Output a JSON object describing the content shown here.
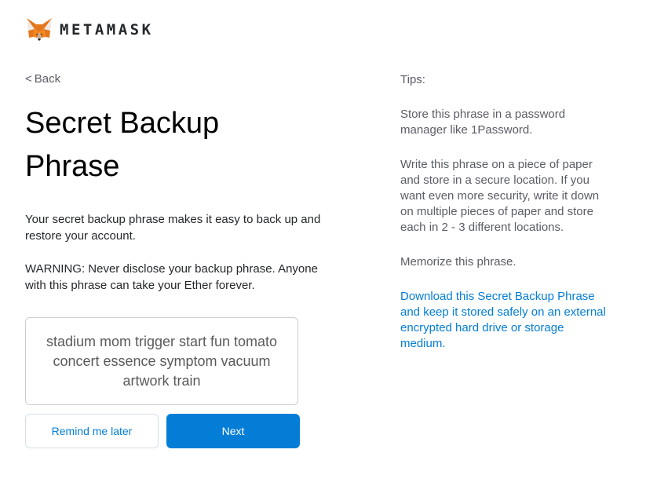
{
  "header": {
    "brand": "METAMASK",
    "logo_icon": "metamask-fox-icon"
  },
  "nav": {
    "back_chevron": "<",
    "back_label": "Back"
  },
  "main": {
    "title": "Secret Backup Phrase",
    "description": "Your secret backup phrase makes it easy to back up and restore your account.",
    "warning": "WARNING: Never disclose your backup phrase. Anyone with this phrase can take your Ether forever.",
    "seed_phrase": "stadium mom trigger start fun tomato concert essence symptom vacuum artwork train"
  },
  "buttons": {
    "remind_label": "Remind me later",
    "next_label": "Next"
  },
  "tips": {
    "heading": "Tips:",
    "items": [
      "Store this phrase in a password manager like 1Password.",
      "Write this phrase on a piece of paper and store in a secure location. If you want even more security, write it down on multiple pieces of paper and store each in 2 - 3 different locations.",
      "Memorize this phrase."
    ],
    "download_link": "Download this Secret Backup Phrase and keep it stored safely on an external encrypted hard drive or storage medium."
  },
  "colors": {
    "accent": "#037dd6",
    "text": "#24272a",
    "muted": "#5b5d67",
    "fox_orange": "#e2761b"
  }
}
